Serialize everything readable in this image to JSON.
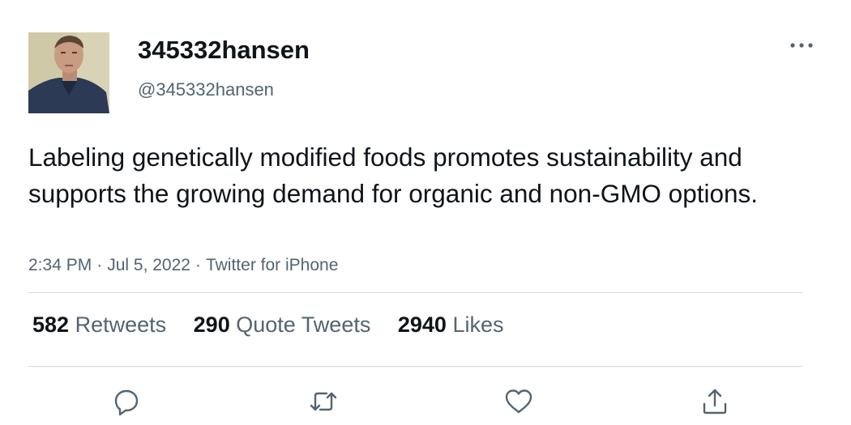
{
  "user": {
    "display_name": "345332hansen",
    "handle": "@345332hansen"
  },
  "tweet": {
    "text": "Labeling genetically modified foods promotes sustainability and supports the growing demand for organic and non-GMO options.",
    "time": "2:34 PM",
    "date": "Jul 5, 2022",
    "source": "Twitter for iPhone",
    "separator": "·"
  },
  "stats": {
    "retweets_count": "582",
    "retweets_label": "Retweets",
    "quotes_count": "290",
    "quotes_label": "Quote Tweets",
    "likes_count": "2940",
    "likes_label": "Likes"
  },
  "icons": {
    "more": "more-horizontal-icon",
    "reply": "reply-icon",
    "retweet": "retweet-icon",
    "like": "heart-icon",
    "share": "share-icon"
  },
  "colors": {
    "text_primary": "#0f1419",
    "text_secondary": "#536471",
    "divider": "#cfd9de",
    "icon": "#536471"
  }
}
